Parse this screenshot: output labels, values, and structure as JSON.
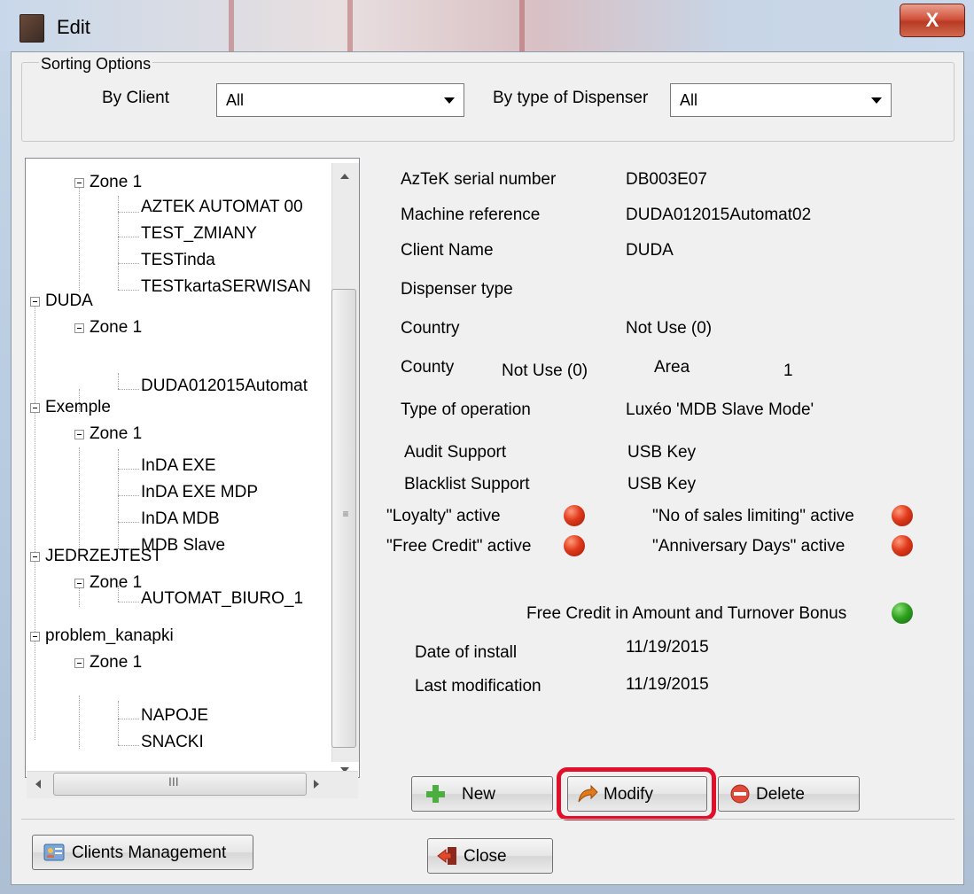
{
  "window": {
    "title": "Edit",
    "close_glyph": "X"
  },
  "sorting": {
    "legend": "Sorting Options",
    "by_client_label": "By Client",
    "by_client_value": "All",
    "by_type_label": "By type of Dispenser",
    "by_type_value": "All"
  },
  "tree": [
    {
      "label": "Zone 1"
    },
    {
      "label": "AZTEK AUTOMAT 00"
    },
    {
      "label": "TEST_ZMIANY"
    },
    {
      "label": "TESTinda"
    },
    {
      "label": "TESTkartaSERWISAN"
    },
    {
      "label": "DUDA"
    },
    {
      "label": "Zone 1"
    },
    {
      "label": "DUDA012015Automat"
    },
    {
      "label": "Exemple"
    },
    {
      "label": "Zone 1"
    },
    {
      "label": "InDA EXE"
    },
    {
      "label": "InDA EXE MDP"
    },
    {
      "label": "InDA MDB"
    },
    {
      "label": "MDB Slave"
    },
    {
      "label": "JEDRZEJTEST"
    },
    {
      "label": "Zone 1"
    },
    {
      "label": "AUTOMAT_BIURO_1"
    },
    {
      "label": "problem_kanapki"
    },
    {
      "label": "Zone 1"
    },
    {
      "label": "NAPOJE"
    },
    {
      "label": "SNACKI"
    }
  ],
  "hscroll_mark": "III",
  "details": {
    "serial_label": "AzTeK serial number",
    "serial_value": "DB003E07",
    "machine_label": "Machine reference",
    "machine_value": "DUDA012015Automat02",
    "client_label": "Client Name",
    "client_value": "DUDA",
    "dispenser_label": "Dispenser type",
    "dispenser_value": "",
    "country_label": "Country",
    "country_value": "Not Use (0)",
    "county_label": "County",
    "county_value": "Not Use (0)",
    "area_label": "Area",
    "area_value": "1",
    "operation_label": "Type of operation",
    "operation_value": "Luxéo 'MDB Slave Mode'",
    "audit_label": "Audit Support",
    "audit_value": "USB Key",
    "blacklist_label": "Blacklist Support",
    "blacklist_value": "USB Key",
    "loyalty_label": "\"Loyalty\" active",
    "free_credit_label": "\"Free Credit\" active",
    "sales_limit_label": "\"No of sales limiting\" active",
    "anniversary_label": "\"Anniversary Days\" active",
    "bonus_label": "Free Credit in Amount and Turnover Bonus",
    "install_label": "Date of install",
    "install_value": "11/19/2015",
    "modified_label": "Last modification",
    "modified_value": "11/19/2015"
  },
  "status_colors": {
    "inactive": "#e0391b",
    "active": "#2fa21f"
  },
  "buttons": {
    "new": "New",
    "modify": "Modify",
    "delete": "Delete",
    "clients": "Clients Management",
    "close": "Close"
  },
  "icons": {
    "new": "plus-icon",
    "modify": "modify-arrow-icon",
    "delete": "minus-icon",
    "clients": "clients-icon",
    "close": "exit-icon"
  },
  "highlight_color": "#e0102a"
}
